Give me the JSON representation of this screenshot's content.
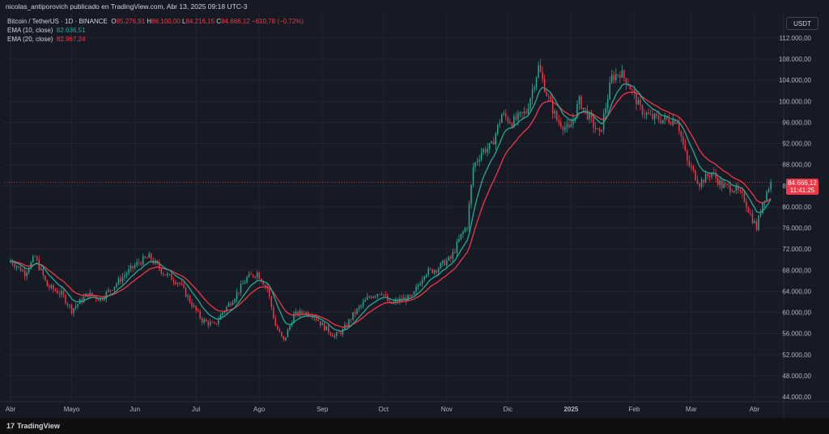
{
  "header": {
    "publish_line": "nicolas_antiporovich publicado en TradingView.com, Abr 13, 2025 09:18 UTC-3"
  },
  "legend": {
    "symbol": "Bitcoin / TetherUS · 1D · BINANCE",
    "o_label": "O",
    "o_value": "85.276,91",
    "h_label": "H",
    "h_value": "86.100,00",
    "l_label": "L",
    "l_value": "84.216,15",
    "c_label": "C",
    "c_value": "84.666,12",
    "change": "−610,78 (−0,72%)",
    "ema10_label": "EMA (10, close)",
    "ema10_value": "82.636,51",
    "ema20_label": "EMA (20, close)",
    "ema20_value": "82.967,24"
  },
  "currency_button": "USDT",
  "price_tag": {
    "price": "84.666,12",
    "countdown": "11:41:25"
  },
  "footer": {
    "brand_mark": "17",
    "brand": "TradingView"
  },
  "colors": {
    "up": "#22AB94",
    "down": "#F23645",
    "ema10": "#22AB94",
    "ema20": "#F23645",
    "background": "#161A25",
    "grid": "#232632"
  },
  "chart_data": {
    "type": "candlestick",
    "title": "Bitcoin / TetherUS · 1D · BINANCE",
    "xlabel": "",
    "ylabel": "",
    "ylim": [
      42000,
      114000
    ],
    "yticks": [
      {
        "value": 112000,
        "label": "112.000,00"
      },
      {
        "value": 108000,
        "label": "108.000,00"
      },
      {
        "value": 104000,
        "label": "104.000,00"
      },
      {
        "value": 100000,
        "label": "100.000,00"
      },
      {
        "value": 96000,
        "label": "96.000,00"
      },
      {
        "value": 92000,
        "label": "92.000,00"
      },
      {
        "value": 88000,
        "label": "88.000,00"
      },
      {
        "value": 84000,
        "label": "84.000,00"
      },
      {
        "value": 80000,
        "label": "80.000,00"
      },
      {
        "value": 76000,
        "label": "76.000,00"
      },
      {
        "value": 72000,
        "label": "72.000,00"
      },
      {
        "value": 68000,
        "label": "68.000,00"
      },
      {
        "value": 64000,
        "label": "64.000,00"
      },
      {
        "value": 60000,
        "label": "60.000,00"
      },
      {
        "value": 56000,
        "label": "56.000,00"
      },
      {
        "value": 52000,
        "label": "52.000,00"
      },
      {
        "value": 48000,
        "label": "48.000,00"
      },
      {
        "value": 44000,
        "label": "44.000,00"
      }
    ],
    "xticks": [
      {
        "day": 0,
        "label": "Abr"
      },
      {
        "day": 30,
        "label": "Mayo"
      },
      {
        "day": 61,
        "label": "Jun"
      },
      {
        "day": 91,
        "label": "Jul"
      },
      {
        "day": 122,
        "label": "Ago"
      },
      {
        "day": 153,
        "label": "Sep"
      },
      {
        "day": 183,
        "label": "Oct"
      },
      {
        "day": 214,
        "label": "Nov"
      },
      {
        "day": 244,
        "label": "Dic"
      },
      {
        "day": 275,
        "label": "2025"
      },
      {
        "day": 306,
        "label": "Feb"
      },
      {
        "day": 334,
        "label": "Mar"
      },
      {
        "day": 365,
        "label": "Abr"
      }
    ],
    "last_price": 84666.12,
    "close_anchors": [
      [
        0,
        69800
      ],
      [
        7,
        67500
      ],
      [
        12,
        70500
      ],
      [
        18,
        65000
      ],
      [
        25,
        63500
      ],
      [
        30,
        60500
      ],
      [
        38,
        63500
      ],
      [
        44,
        62500
      ],
      [
        52,
        65500
      ],
      [
        57,
        67500
      ],
      [
        63,
        69500
      ],
      [
        68,
        70500
      ],
      [
        75,
        67500
      ],
      [
        83,
        65500
      ],
      [
        89,
        61500
      ],
      [
        94,
        58500
      ],
      [
        100,
        57500
      ],
      [
        104,
        60000
      ],
      [
        110,
        63000
      ],
      [
        116,
        66500
      ],
      [
        121,
        67500
      ],
      [
        126,
        64500
      ],
      [
        130,
        57500
      ],
      [
        134,
        54500
      ],
      [
        139,
        59500
      ],
      [
        144,
        60000
      ],
      [
        149,
        59500
      ],
      [
        153,
        57500
      ],
      [
        159,
        55500
      ],
      [
        163,
        56500
      ],
      [
        168,
        59500
      ],
      [
        176,
        63000
      ],
      [
        182,
        64000
      ],
      [
        186,
        61500
      ],
      [
        192,
        62500
      ],
      [
        197,
        62800
      ],
      [
        203,
        67500
      ],
      [
        209,
        68200
      ],
      [
        213,
        69500
      ],
      [
        216,
        70200
      ],
      [
        221,
        74500
      ],
      [
        224,
        76500
      ],
      [
        227,
        87500
      ],
      [
        231,
        90500
      ],
      [
        236,
        91500
      ],
      [
        241,
        97500
      ],
      [
        246,
        96000
      ],
      [
        253,
        98000
      ],
      [
        259,
        106500
      ],
      [
        263,
        101500
      ],
      [
        268,
        96500
      ],
      [
        274,
        94500
      ],
      [
        279,
        100000
      ],
      [
        283,
        97500
      ],
      [
        289,
        93500
      ],
      [
        295,
        104500
      ],
      [
        299,
        105500
      ],
      [
        303,
        103500
      ],
      [
        309,
        98500
      ],
      [
        314,
        97000
      ],
      [
        320,
        96500
      ],
      [
        327,
        96500
      ],
      [
        332,
        88500
      ],
      [
        338,
        84500
      ],
      [
        344,
        86500
      ],
      [
        349,
        84000
      ],
      [
        355,
        83500
      ],
      [
        360,
        81500
      ],
      [
        363,
        78500
      ],
      [
        366,
        76000
      ],
      [
        369,
        81000
      ],
      [
        373,
        84666
      ]
    ],
    "ema_10_last": 82636.51,
    "ema_20_last": 82967.24
  }
}
